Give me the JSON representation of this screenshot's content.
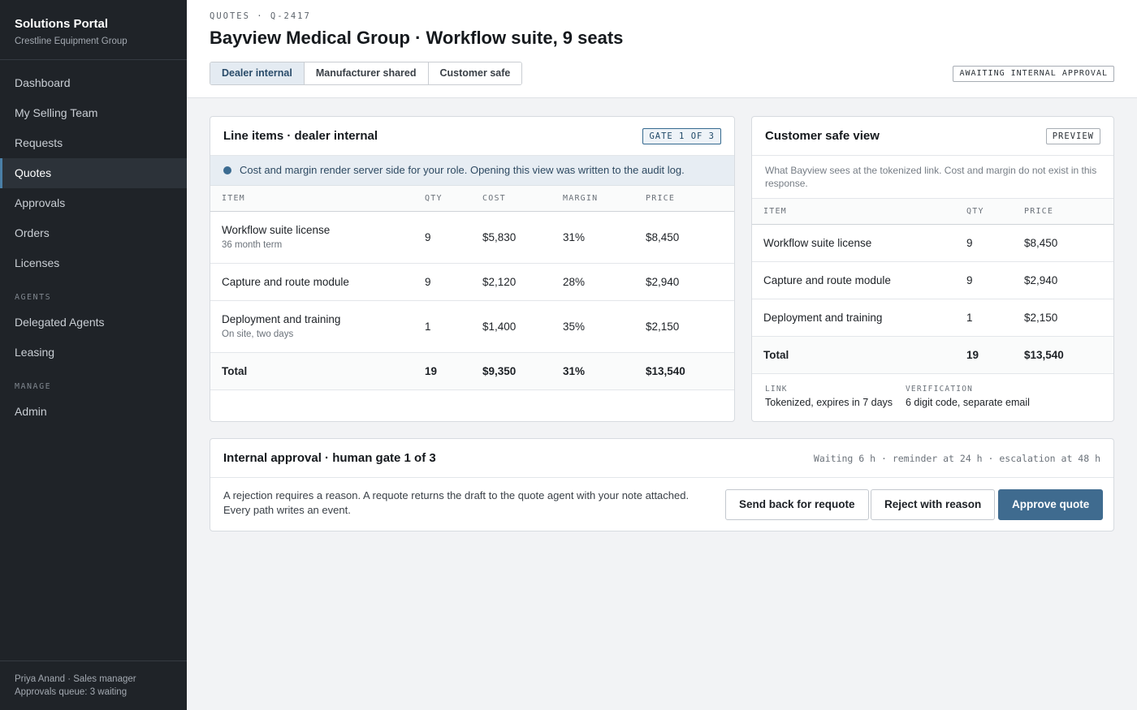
{
  "sidebar": {
    "brand_title": "Solutions Portal",
    "brand_subtitle": "Crestline Equipment Group",
    "items": [
      {
        "label": "Dashboard"
      },
      {
        "label": "My Selling Team"
      },
      {
        "label": "Requests"
      },
      {
        "label": "Quotes",
        "active": true
      },
      {
        "label": "Approvals"
      },
      {
        "label": "Orders"
      },
      {
        "label": "Licenses"
      }
    ],
    "agents_section": "AGENTS",
    "agents_items": [
      {
        "label": "Delegated Agents"
      },
      {
        "label": "Leasing"
      }
    ],
    "manage_section": "MANAGE",
    "manage_items": [
      {
        "label": "Admin"
      }
    ],
    "footer_user": "Priya Anand · Sales manager",
    "footer_queue": "Approvals queue: 3 waiting"
  },
  "header": {
    "breadcrumb": "QUOTES · Q-2417",
    "title": "Bayview Medical Group · Workflow suite, 9 seats",
    "tabs": [
      {
        "label": "Dealer internal",
        "active": true
      },
      {
        "label": "Manufacturer shared"
      },
      {
        "label": "Customer safe"
      }
    ],
    "status": "AWAITING INTERNAL APPROVAL"
  },
  "line_items": {
    "title": "Line items · dealer internal",
    "gate_badge": "GATE 1 OF 3",
    "notice": "Cost and margin render server side for your role. Opening this view was written to the audit log.",
    "columns": [
      "ITEM",
      "QTY",
      "COST",
      "MARGIN",
      "PRICE"
    ],
    "rows": [
      {
        "item": "Workflow suite license",
        "sub": "36 month term",
        "qty": "9",
        "cost": "$5,830",
        "margin": "31%",
        "price": "$8,450"
      },
      {
        "item": "Capture and route module",
        "sub": "",
        "qty": "9",
        "cost": "$2,120",
        "margin": "28%",
        "price": "$2,940"
      },
      {
        "item": "Deployment and training",
        "sub": "On site, two days",
        "qty": "1",
        "cost": "$1,400",
        "margin": "35%",
        "price": "$2,150"
      }
    ],
    "total": {
      "item": "Total",
      "qty": "19",
      "cost": "$9,350",
      "margin": "31%",
      "price": "$13,540"
    }
  },
  "customer_view": {
    "title": "Customer safe view",
    "badge": "PREVIEW",
    "note": "What Bayview sees at the tokenized link. Cost and margin do not exist in this response.",
    "columns": [
      "ITEM",
      "QTY",
      "PRICE"
    ],
    "rows": [
      {
        "item": "Workflow suite license",
        "qty": "9",
        "price": "$8,450"
      },
      {
        "item": "Capture and route module",
        "qty": "9",
        "price": "$2,940"
      },
      {
        "item": "Deployment and training",
        "qty": "1",
        "price": "$2,150"
      }
    ],
    "total": {
      "item": "Total",
      "qty": "19",
      "price": "$13,540"
    },
    "link_label": "LINK",
    "link_value": "Tokenized, expires in 7 days",
    "verification_label": "VERIFICATION",
    "verification_value": "6 digit code, separate email"
  },
  "approval": {
    "title": "Internal approval · human gate 1 of 3",
    "timer": "Waiting 6 h · reminder at 24 h · escalation at 48 h",
    "text": "A rejection requires a reason. A requote returns the draft to the quote agent with your note attached. Every path writes an event.",
    "requote_button": "Send back for requote",
    "reject_button": "Reject with reason",
    "approve_button": "Approve quote"
  },
  "colors": {
    "sidebar_bg": "#1f2328",
    "accent": "#3f6b8f",
    "page_bg": "#f2f3f5"
  }
}
